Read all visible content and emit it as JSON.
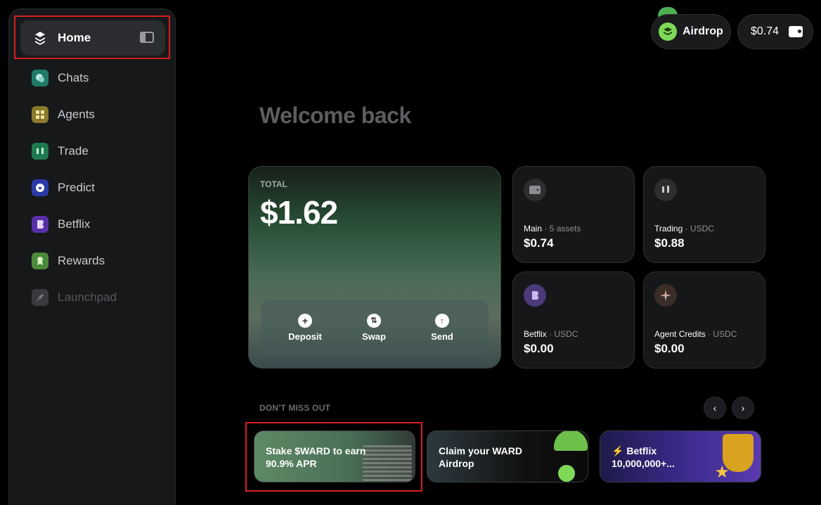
{
  "sidebar": {
    "items": [
      {
        "label": "Home",
        "icon": "ward-logo-icon",
        "color": "#2b2c30"
      },
      {
        "label": "Chats",
        "icon": "chat-bubbles-icon",
        "color": "#1f7a6a"
      },
      {
        "label": "Agents",
        "icon": "grid-icon",
        "color": "#8a7a2a"
      },
      {
        "label": "Trade",
        "icon": "candlestick-icon",
        "color": "#1e7a4e"
      },
      {
        "label": "Predict",
        "icon": "shield-heart-icon",
        "color": "#2a3aa8"
      },
      {
        "label": "Betflix",
        "icon": "betflix-icon",
        "color": "#5a2fa8"
      },
      {
        "label": "Rewards",
        "icon": "badge-icon",
        "color": "#4a8a3a"
      },
      {
        "label": "Launchpad",
        "icon": "rocket-icon",
        "color": "#3a3b3e"
      }
    ]
  },
  "header": {
    "airdrop_label": "Airdrop",
    "balance": "$0.74"
  },
  "main": {
    "welcome": "Welcome back",
    "total_label": "TOTAL",
    "total_value": "$1.62",
    "actions": [
      "Deposit",
      "Swap",
      "Send"
    ],
    "assets": [
      {
        "name": "Main",
        "sub": " · 5 assets",
        "value": "$0.74",
        "icon": "wallet-icon"
      },
      {
        "name": "Trading",
        "sub": " · USDC",
        "value": "$0.88",
        "icon": "candlestick-icon"
      },
      {
        "name": "Betflix",
        "sub": " · USDC",
        "value": "$0.00",
        "icon": "betflix-icon"
      },
      {
        "name": "Agent Credits",
        "sub": " · USDC",
        "value": "$0.00",
        "icon": "sparkle-icon"
      }
    ],
    "dont_miss_out": "DON'T MISS OUT",
    "promos": [
      {
        "line1": "Stake $WARD to earn",
        "line2": "90.9% APR"
      },
      {
        "line1": "Claim your WARD",
        "line2": "Airdrop"
      },
      {
        "line1": "Betflix",
        "line2": "10,000,000+..."
      }
    ]
  },
  "colors": {
    "accent": "#7ed957",
    "highlight": "#d81e1e"
  }
}
